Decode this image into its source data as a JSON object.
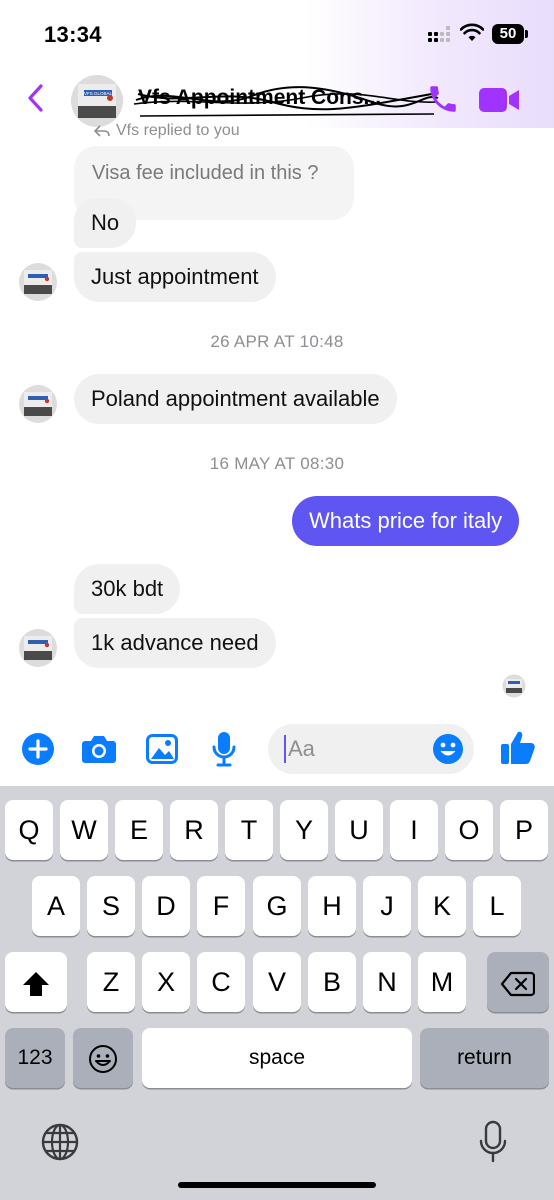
{
  "status_bar": {
    "time": "13:34",
    "battery": "50"
  },
  "header": {
    "contact_name": "Vfs Appointment Cons...",
    "avatar_label": "VFS.GLOBAL"
  },
  "messages": {
    "replied_note": "Vfs replied to you",
    "quoted": "Visa fee included in this ?",
    "m1": "No",
    "m2": "Just appointment",
    "ts1": "26 APR AT 10:48",
    "m3": "Poland appointment available",
    "ts2": "16 MAY AT 08:30",
    "m4": "Whats price for italy",
    "m5": "30k bdt",
    "m6": "1k advance need"
  },
  "composer": {
    "placeholder": "Aa"
  },
  "keyboard": {
    "row1": [
      "Q",
      "W",
      "E",
      "R",
      "T",
      "Y",
      "U",
      "I",
      "O",
      "P"
    ],
    "row2": [
      "A",
      "S",
      "D",
      "F",
      "G",
      "H",
      "J",
      "K",
      "L"
    ],
    "row3": [
      "Z",
      "X",
      "C",
      "V",
      "B",
      "N",
      "M"
    ],
    "numbers_label": "123",
    "space_label": "space",
    "return_label": "return"
  },
  "colors": {
    "accent": "#5e55f2",
    "messenger_purple": "#a033ff",
    "composer_blue": "#0a7cff"
  }
}
